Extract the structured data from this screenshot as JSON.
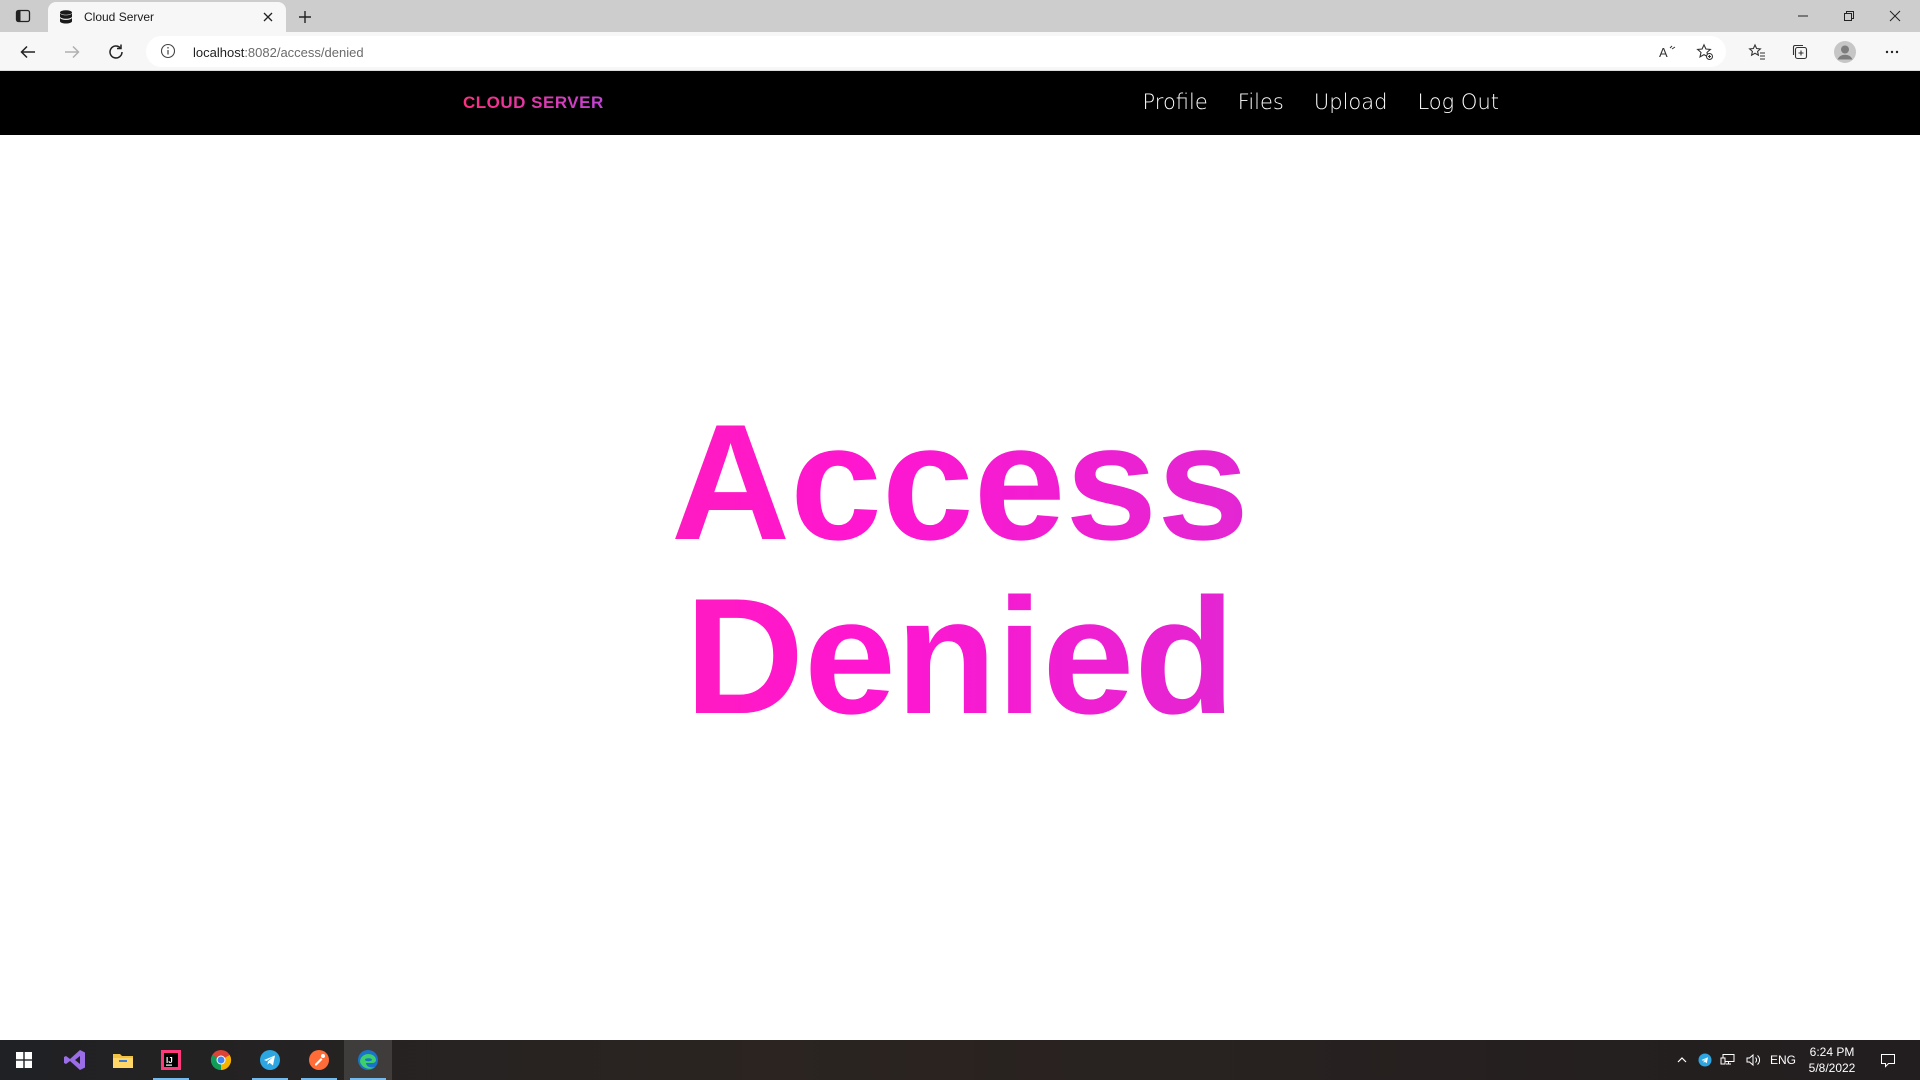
{
  "browser": {
    "tab": {
      "title": "Cloud Server"
    },
    "address": {
      "host": "localhost",
      "rest": ":8082/access/denied"
    }
  },
  "site": {
    "brand": "CLOUD SERVER",
    "nav": [
      "Profile",
      "Files",
      "Upload",
      "Log Out"
    ],
    "hero": {
      "line1": "Access",
      "line2": "Denied"
    }
  },
  "taskbar": {
    "language": "ENG",
    "time": "6:24 PM",
    "date": "5/8/2022"
  },
  "colors": {
    "brand_start": "#ff2f7e",
    "brand_end": "#c243d6",
    "hero_start": "#ff2d8e",
    "hero_mid": "#ff16d0",
    "hero_end": "#b044d8",
    "nav_bg": "#000000"
  },
  "icons": {
    "tab_actions": "tab-actions-icon",
    "favicon": "database-icon",
    "back": "back-arrow-icon",
    "forward": "forward-arrow-icon",
    "refresh": "refresh-icon",
    "site_info": "info-icon",
    "read_aloud": "read-aloud-icon",
    "favorite": "add-favorite-icon",
    "favorites": "favorites-icon",
    "collections": "collections-icon",
    "profile": "profile-avatar-icon",
    "menu": "more-icon"
  }
}
